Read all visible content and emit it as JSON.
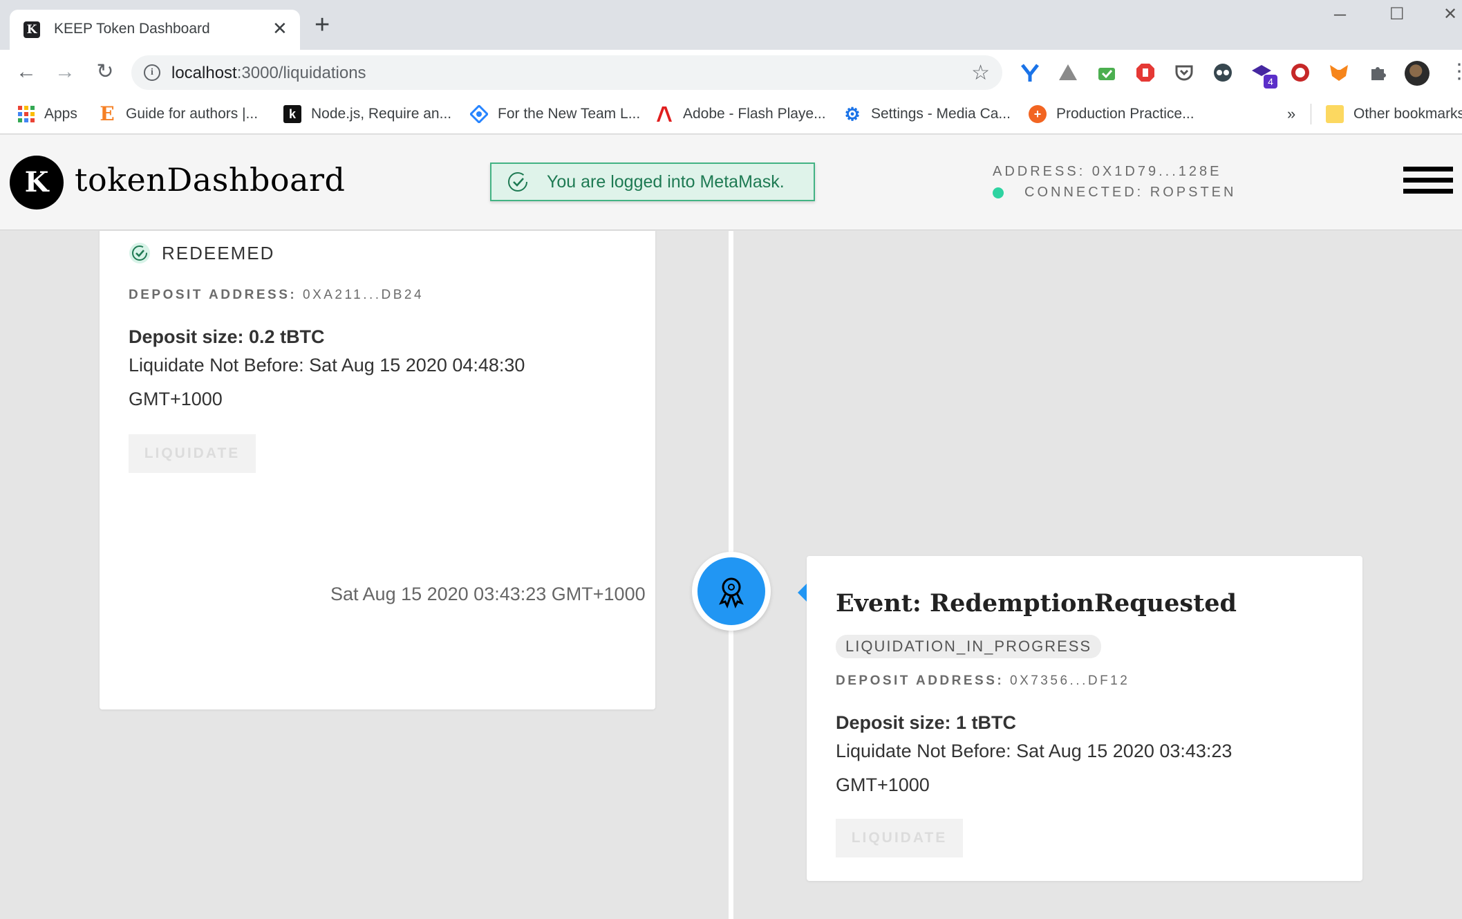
{
  "browser": {
    "tab_title": "KEEP Token Dashboard",
    "tab_favicon": "K",
    "new_tab_label": "+",
    "url_host": "localhost",
    "url_path": ":3000/liquidations",
    "extension_badge": "4",
    "bookmarks": [
      {
        "label": "Apps",
        "icon": "apps-grid-icon"
      },
      {
        "label": "Guide for authors |...",
        "icon": "elsevier-e-icon"
      },
      {
        "label": "Node.js, Require an...",
        "icon": "k-icon"
      },
      {
        "label": "For the New Team L...",
        "icon": "diamond-icon"
      },
      {
        "label": "Adobe - Flash Playe...",
        "icon": "adobe-icon"
      },
      {
        "label": "Settings - Media Ca...",
        "icon": "gear-icon"
      },
      {
        "label": "Production Practice...",
        "icon": "plus-circle-icon"
      }
    ],
    "overflow_label": "»",
    "other_bookmarks": "Other bookmarks"
  },
  "header": {
    "logo": "K",
    "brand": "tokenDashboard",
    "toast": "You are logged into MetaMask.",
    "address": "ADDRESS: 0X1D79...128E",
    "connected": "CONNECTED: ROPSTEN"
  },
  "events": [
    {
      "status": "REDEEMED",
      "deposit_address_label": "DEPOSIT ADDRESS:",
      "deposit_address": "0XA211...DB24",
      "deposit_size": "Deposit size: 0.2 tBTC",
      "liquidate_not_before": "Liquidate Not Before: Sat Aug 15 2020 04:48:30 GMT+1000",
      "button": "LIQUIDATE"
    },
    {
      "date": "Sat Aug 15 2020 03:43:23 GMT+1000",
      "title": "Event: RedemptionRequested",
      "status": "LIQUIDATION_IN_PROGRESS",
      "deposit_address_label": "DEPOSIT ADDRESS:",
      "deposit_address": "0X7356...DF12",
      "deposit_size": "Deposit size: 1 tBTC",
      "liquidate_not_before": "Liquidate Not Before: Sat Aug 15 2020 03:43:23 GMT+1000",
      "button": "LIQUIDATE"
    }
  ],
  "colors": {
    "accent": "#2196f3",
    "success": "#43b384",
    "connected_dot": "#2ed3a1"
  }
}
